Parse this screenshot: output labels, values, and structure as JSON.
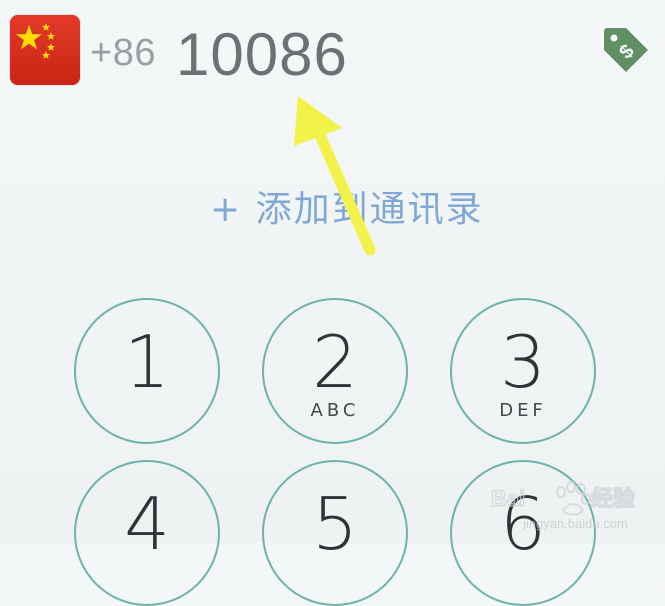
{
  "dialer": {
    "country_flag": "china-flag-icon",
    "country_code": "+86",
    "number": "10086",
    "add_contact": "+ 添加到通讯录",
    "price_icon": "price-tag-icon"
  },
  "keypad": [
    {
      "digit": "1",
      "letters": ""
    },
    {
      "digit": "2",
      "letters": "ABC"
    },
    {
      "digit": "3",
      "letters": "DEF"
    },
    {
      "digit": "4",
      "letters": ""
    },
    {
      "digit": "5",
      "letters": ""
    },
    {
      "digit": "6",
      "letters": ""
    }
  ],
  "annotation": {
    "arrow_color": "#f2f24a"
  },
  "watermark": {
    "text_cn": "经验",
    "url": "jingyan.baidu.com"
  },
  "colors": {
    "key_border": "#6bb3ab",
    "link": "#7fa8d6",
    "price_tag": "#5f8f62"
  }
}
